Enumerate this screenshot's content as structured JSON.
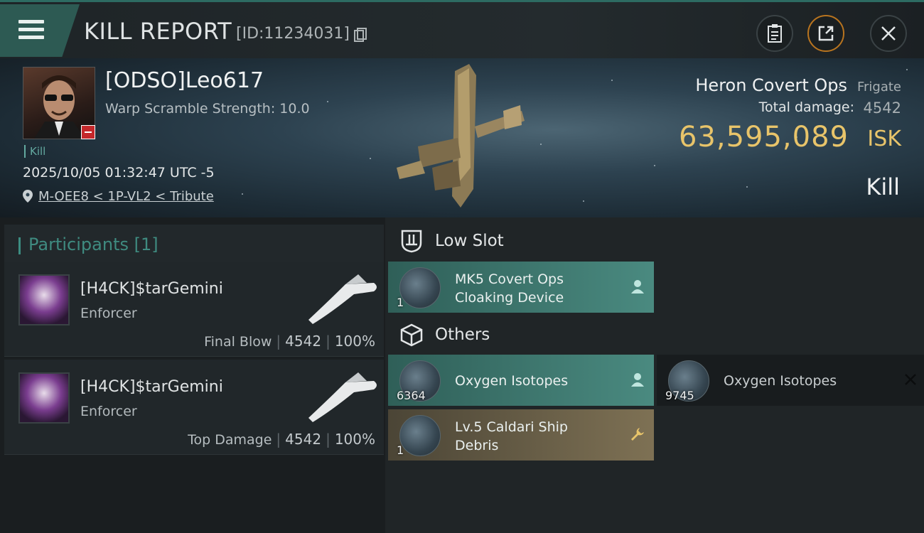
{
  "header": {
    "title": "KILL REPORT",
    "id_text": "[ID:11234031]",
    "icons": [
      "menu-icon",
      "copy-icon",
      "clipboard-icon",
      "share-icon",
      "close-icon"
    ]
  },
  "victim": {
    "name": "[ODSO]Leo617",
    "warp": "Warp Scramble Strength: 10.0",
    "tag": "Kill",
    "datetime": "2025/10/05 01:32:47 UTC -5",
    "location": "M-OEE8 < 1P-VL2 < Tribute",
    "ship_name": "Heron Covert Ops",
    "ship_class": "Frigate",
    "damage_label": "Total damage:",
    "damage_value": "4542",
    "isk_value": "63,595,089",
    "isk_unit": "ISK",
    "result": "Kill"
  },
  "participants": {
    "title": "Participants",
    "count": "[1]",
    "cards": [
      {
        "name": "[H4CK]$tarGemini",
        "role": "Enforcer",
        "label": "Final Blow",
        "damage": "4542",
        "percent": "100%"
      },
      {
        "name": "[H4CK]$tarGemini",
        "role": "Enforcer",
        "label": "Top Damage",
        "damage": "4542",
        "percent": "100%"
      }
    ]
  },
  "sections": {
    "low_slot": {
      "title": "Low Slot",
      "items": [
        {
          "name": "MK5 Covert Ops Cloaking Device",
          "qty": "1",
          "status": "dropped"
        }
      ]
    },
    "others": {
      "title": "Others",
      "items": [
        {
          "name": "Oxygen Isotopes",
          "qty": "6364",
          "status": "dropped"
        },
        {
          "name": "Oxygen Isotopes",
          "qty": "9745",
          "status": "destroyed"
        },
        {
          "name": "Lv.5 Caldari Ship Debris",
          "qty": "1",
          "status": "salvage"
        }
      ]
    }
  },
  "colors": {
    "accent_teal": "#3f8b80",
    "isk_gold": "#e8c46a",
    "badge_red": "#c4282b"
  }
}
